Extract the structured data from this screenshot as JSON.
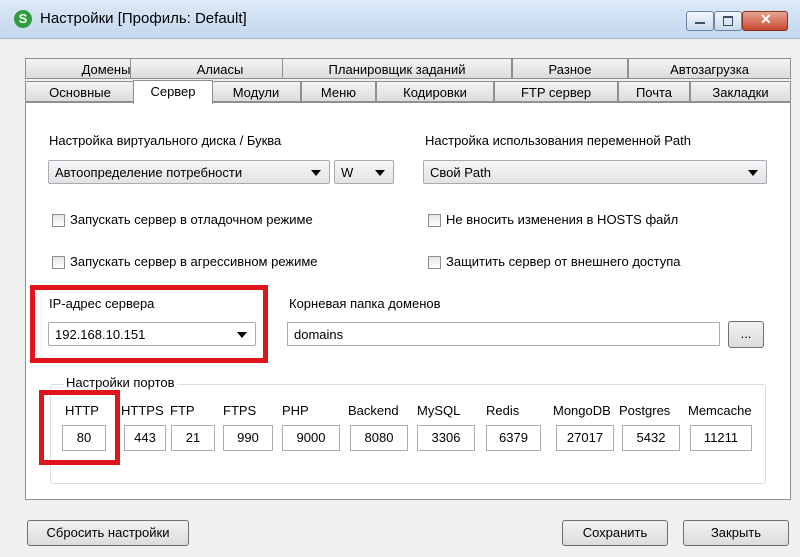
{
  "window": {
    "title": "Настройки [Профиль: Default]",
    "app_icon": "S"
  },
  "tabs": {
    "row1": [
      "Домены",
      "Алиасы",
      "Планировщик заданий",
      "Разное",
      "Автозагрузка"
    ],
    "row2": [
      "Основные",
      "Сервер",
      "Модули",
      "Меню",
      "Кодировки",
      "FTP сервер",
      "Почта",
      "Закладки"
    ],
    "active": "Сервер"
  },
  "server": {
    "vdisk_label": "Настройка виртуального диска / Буква",
    "vdisk_value": "Автоопределение потребности",
    "drive_letter": "W",
    "path_label": "Настройка использования переменной Path",
    "path_value": "Свой Path",
    "debug_mode": "Запускать сервер в отладочном режиме",
    "aggressive_mode": "Запускать сервер в агрессивном режиме",
    "no_hosts": "Не вносить изменения в HOSTS файл",
    "protect": "Защитить сервер от внешнего доступа",
    "ip_label": "IP-адрес сервера",
    "ip_value": "192.168.10.151",
    "root_label": "Корневая папка доменов",
    "root_value": "domains",
    "browse": "..."
  },
  "ports": {
    "title": "Настройки портов",
    "items": [
      {
        "name": "HTTP",
        "value": "80"
      },
      {
        "name": "HTTPS",
        "value": "443"
      },
      {
        "name": "FTP",
        "value": "21"
      },
      {
        "name": "FTPS",
        "value": "990"
      },
      {
        "name": "PHP",
        "value": "9000"
      },
      {
        "name": "Backend",
        "value": "8080"
      },
      {
        "name": "MySQL",
        "value": "3306"
      },
      {
        "name": "Redis",
        "value": "6379"
      },
      {
        "name": "MongoDB",
        "value": "27017"
      },
      {
        "name": "Postgres",
        "value": "5432"
      },
      {
        "name": "Memcache",
        "value": "11211"
      }
    ]
  },
  "buttons": {
    "reset": "Сбросить настройки",
    "save": "Сохранить",
    "close": "Закрыть"
  },
  "colors": {
    "highlight": "#e0141d"
  }
}
